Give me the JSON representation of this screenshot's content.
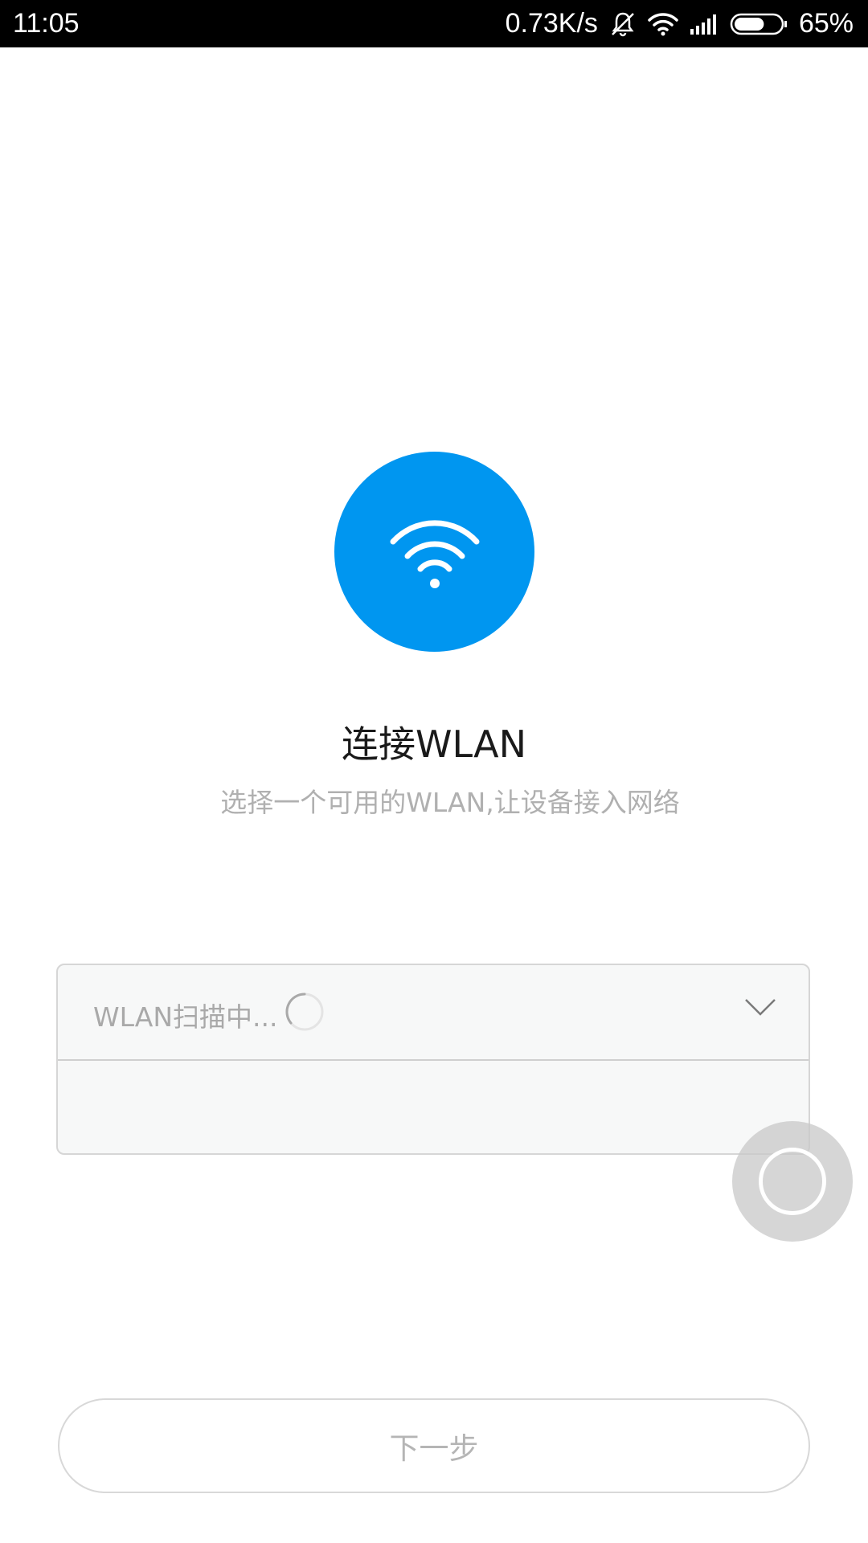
{
  "status_bar": {
    "time": "11:05",
    "net_speed": "0.73K/s",
    "battery": "65%",
    "battery_level": 0.65,
    "icons": [
      "mute-bell-icon",
      "wifi-icon",
      "signal-icon",
      "battery-icon"
    ]
  },
  "hero": {
    "icon": "wifi-icon",
    "color": "#0096f0"
  },
  "title": "连接WLAN",
  "subtitle": "选择一个可用的WLAN,让设备接入网络",
  "network_selector": {
    "scan_text": "WLAN扫描中...",
    "icons": [
      "loading-spinner-icon",
      "chevron-down-icon"
    ]
  },
  "float_button": {
    "icon": "assistive-touch-icon"
  },
  "next_button": {
    "label": "下一步"
  }
}
